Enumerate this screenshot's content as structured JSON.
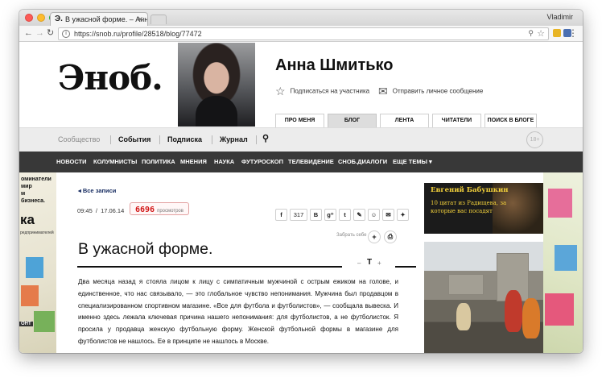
{
  "browser": {
    "user": "Vladimir",
    "tab_title": "В ужасной форме. – Анна Ш",
    "url": "https://snob.ru/profile/28518/blog/77472"
  },
  "site": {
    "logo": "Эноб."
  },
  "profile": {
    "name": "Анна Шмитько",
    "subscribe": "Подписаться на участника",
    "message": "Отправить личное сообщение",
    "tabs": [
      "ПРО МЕНЯ",
      "БЛОГ",
      "ЛЕНТА",
      "ЧИТАТЕЛИ",
      "ПОИСК В БЛОГЕ"
    ],
    "active_tab": "БЛОГ"
  },
  "top_nav": {
    "items": [
      "Сообщество",
      "События",
      "Подписка",
      "Журнал"
    ],
    "age": "18+"
  },
  "dark_nav": {
    "items": [
      "НОВОСТИ",
      "КОЛУМНИСТЫ",
      "ПОЛИТИКА",
      "МНЕНИЯ",
      "НАУКА",
      "ФУТУРОСКОП",
      "ТЕЛЕВИДЕНИЕ",
      "СНОБ.ДИАЛОГИ",
      "ЕЩЕ ТЕМЫ ▾"
    ]
  },
  "left_ad": {
    "line1": "оминатели",
    "line2": "мир",
    "line3": "м",
    "line4": "бизнеса.",
    "big": "ка",
    "small": "редпринимателей",
    "sign": "ОНТ"
  },
  "article": {
    "back": "◂ Все записи",
    "time": "09:45",
    "date": "17.06.14",
    "views": "6696",
    "views_label": "просмотров",
    "share_count": "317",
    "save": "Забрать себе",
    "title": "В ужасной форме.",
    "body": "Два месяца назад я стояла лицом к лицу с симпатичным мужчиной с острым ежиком на голове, и единственное, что нас связывало, — это глобальное чувство непонимания. Мужчина был продавцом в специализированном спортивном магазине. «Все для футбола и футболистов», — сообщала вывеска. И именно здесь лежала ключевая причина нашего непонимания: для футболистов, а не футболисток. Я просила у продавца женскую футбольную форму. Женской футбольной формы в магазине для футболистов не нашлось. Ее в принципе не нашлось в Москве."
  },
  "promo": {
    "name": "Евгений Бабушкин",
    "text": "10 цитат из Радищева, за которые вас посадят"
  }
}
